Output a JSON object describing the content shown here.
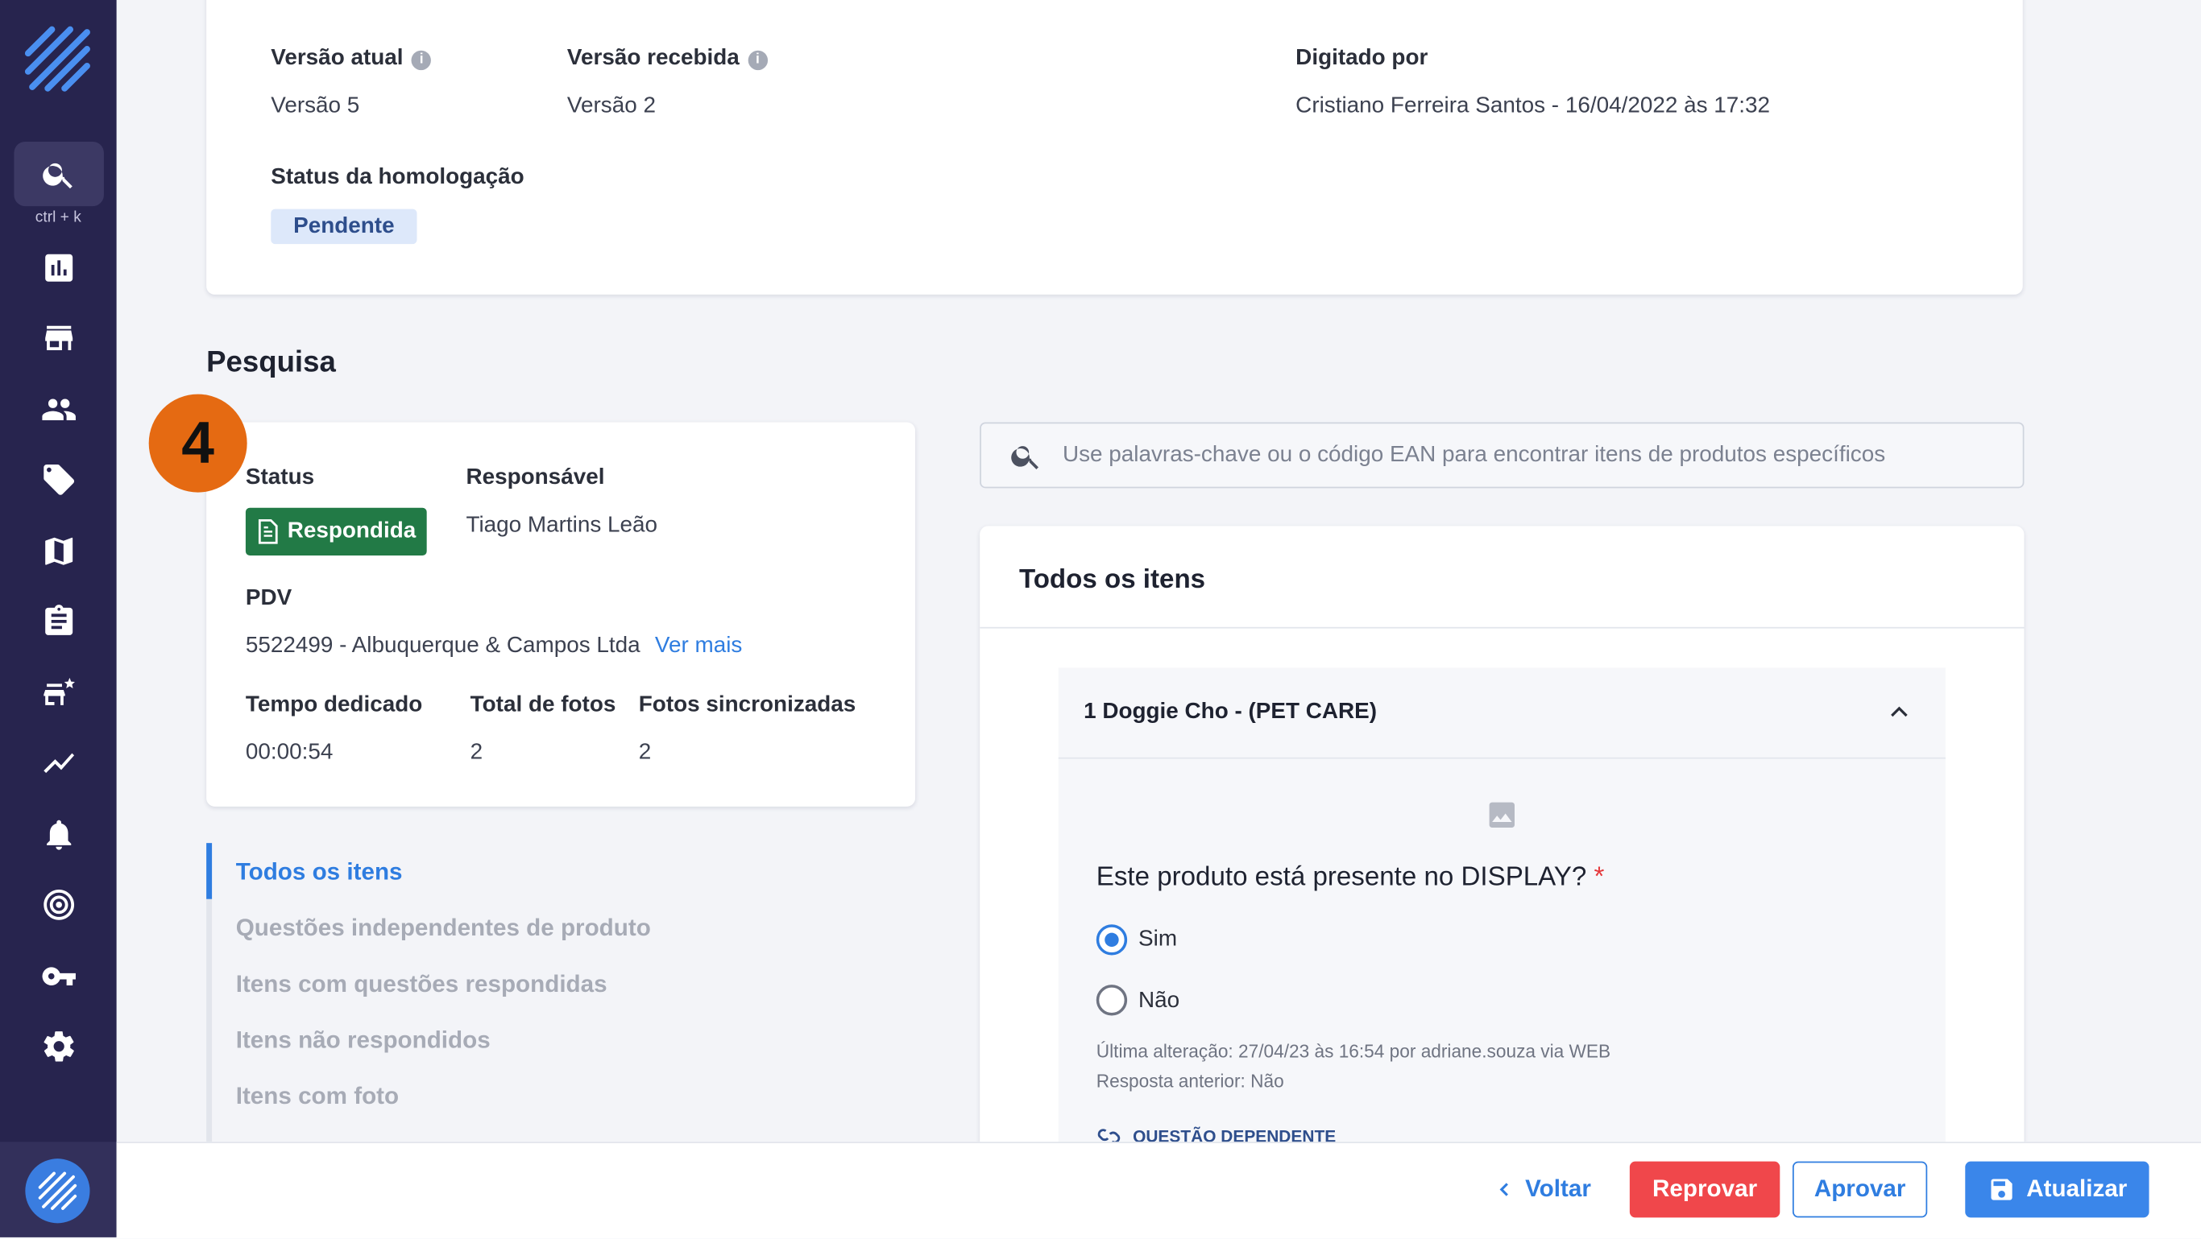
{
  "sidebar": {
    "search_shortcut": "ctrl + k",
    "items": [
      {
        "icon": "chart-icon"
      },
      {
        "icon": "store-icon"
      },
      {
        "icon": "people-icon"
      },
      {
        "icon": "tag-icon"
      },
      {
        "icon": "map-icon"
      },
      {
        "icon": "clipboard-icon"
      },
      {
        "icon": "store-star-icon"
      },
      {
        "icon": "trend-icon"
      },
      {
        "icon": "bell-icon"
      },
      {
        "icon": "target-icon"
      },
      {
        "icon": "key-icon"
      },
      {
        "icon": "settings-icon"
      }
    ]
  },
  "info_card": {
    "current_version_label": "Versão atual",
    "current_version_value": "Versão 5",
    "received_version_label": "Versão recebida",
    "received_version_value": "Versão 2",
    "typed_by_label": "Digitado por",
    "typed_by_value": "Cristiano Ferreira Santos - 16/04/2022 às 17:32",
    "approval_status_label": "Status da homologação",
    "approval_status_value": "Pendente"
  },
  "survey": {
    "section_title": "Pesquisa",
    "step_number": "4",
    "status_label": "Status",
    "status_value": "Respondida",
    "responsible_label": "Responsável",
    "responsible_value": "Tiago Martins Leão",
    "pdv_label": "PDV",
    "pdv_value": "5522499 - Albuquerque & Campos Ltda",
    "see_more": "Ver mais",
    "time_label": "Tempo dedicado",
    "time_value": "00:00:54",
    "total_photos_label": "Total de fotos",
    "total_photos_value": "2",
    "synced_photos_label": "Fotos sincronizadas",
    "synced_photos_value": "2"
  },
  "filters": [
    {
      "label": "Todos os itens",
      "active": true
    },
    {
      "label": "Questões independentes de produto"
    },
    {
      "label": "Itens com questões respondidas"
    },
    {
      "label": "Itens não respondidos"
    },
    {
      "label": "Itens com foto"
    }
  ],
  "search": {
    "placeholder": "Use palavras-chave ou o código EAN para encontrar itens de produtos específicos"
  },
  "items_panel": {
    "title": "Todos os itens",
    "product_title": "1 Doggie Cho - (PET CARE)",
    "question": "Este produto está presente no DISPLAY?",
    "required_mark": "*",
    "options": [
      {
        "label": "Sim",
        "selected": true
      },
      {
        "label": "Não",
        "selected": false
      }
    ],
    "last_change": "Última alteração: 27/04/23 às 16:54 por adriane.souza via WEB",
    "previous_answer": "Resposta anterior:  Não",
    "dependent_question": "QUESTÃO DEPENDENTE"
  },
  "footer": {
    "back": "Voltar",
    "reject": "Reprovar",
    "approve": "Aprovar",
    "update": "Atualizar"
  },
  "colors": {
    "sidebar": "#27244e",
    "accent": "#2f7de0",
    "success": "#227a46",
    "danger": "#f0474b",
    "step_badge": "#e56a12"
  }
}
